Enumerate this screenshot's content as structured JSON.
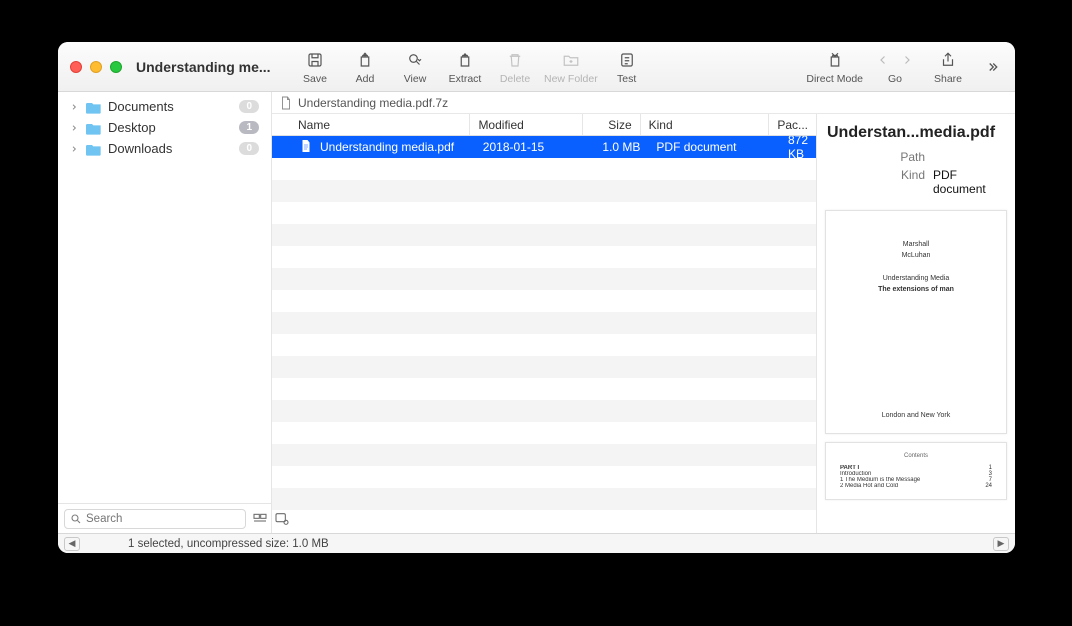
{
  "window": {
    "title": "Understanding me..."
  },
  "toolbar": {
    "save": "Save",
    "add": "Add",
    "view": "View",
    "extract": "Extract",
    "delete": "Delete",
    "newfolder": "New Folder",
    "test": "Test",
    "direct": "Direct Mode",
    "go": "Go",
    "share": "Share"
  },
  "sidebar": {
    "items": [
      {
        "label": "Documents",
        "count": "0"
      },
      {
        "label": "Desktop",
        "count": "1"
      },
      {
        "label": "Downloads",
        "count": "0"
      }
    ],
    "search_placeholder": "Search"
  },
  "crumbs": {
    "path": "Understanding media.pdf.7z"
  },
  "table": {
    "headers": {
      "name": "Name",
      "modified": "Modified",
      "size": "Size",
      "kind": "Kind",
      "packed": "Pac..."
    },
    "rows": [
      {
        "name": "Understanding media.pdf",
        "modified": "2018-01-15",
        "size": "1.0 MB",
        "kind": "PDF document",
        "packed": "872 KB",
        "selected": true
      }
    ]
  },
  "inspector": {
    "title": "Understan...media.pdf",
    "path_label": "Path",
    "kind_label": "Kind",
    "kind_value": "PDF document",
    "preview1": {
      "l1": "Marshall",
      "l2": "McLuhan",
      "l3": "Understanding Media",
      "l4": "The extensions of man",
      "l5": "London and New York"
    },
    "preview2": {
      "title": "Contents",
      "lines": [
        {
          "l": "PART I",
          "r": "1"
        },
        {
          "l": "Introduction",
          "r": "3"
        },
        {
          "l": "1   The Medium is the Message",
          "r": "7"
        },
        {
          "l": "2   Media Hot and Cold",
          "r": "24"
        }
      ]
    }
  },
  "status": {
    "text": "1 selected, uncompressed size: 1.0 MB"
  }
}
